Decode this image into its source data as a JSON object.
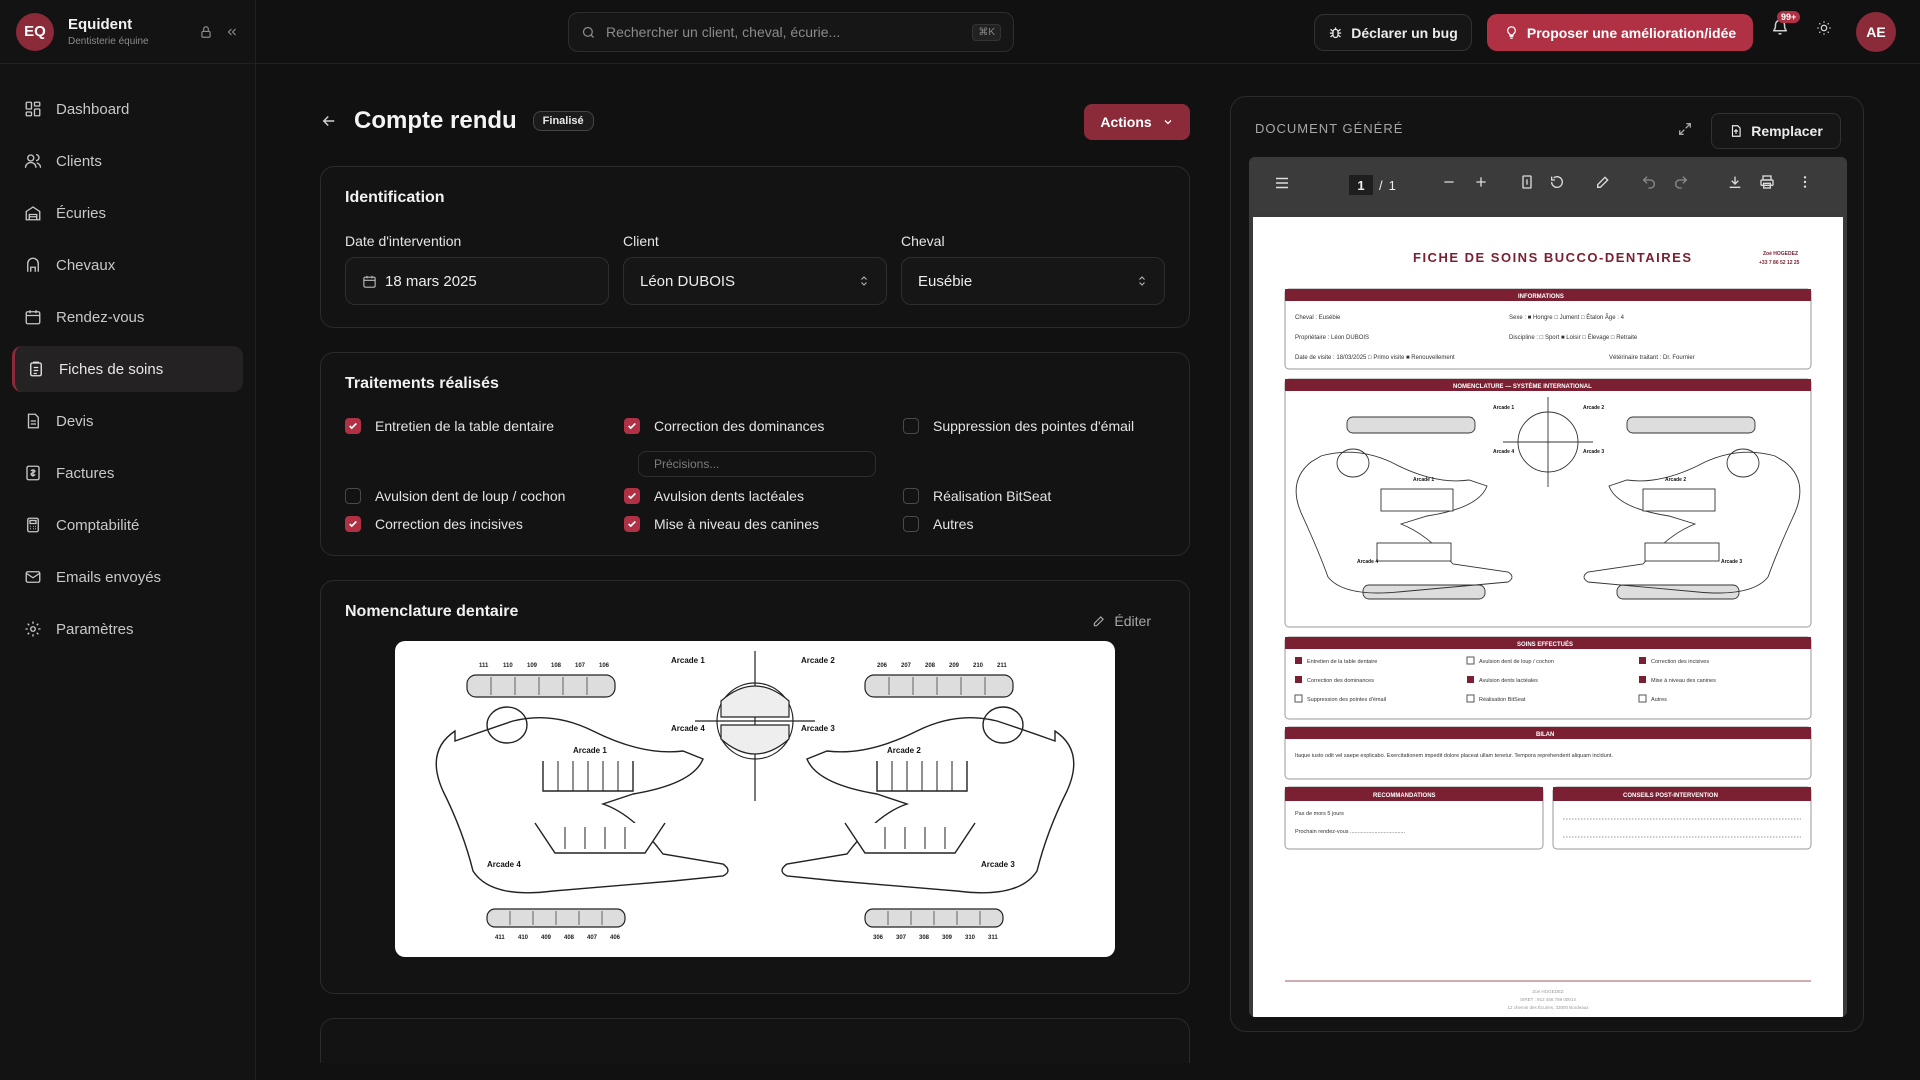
{
  "app": {
    "logo": "EQ",
    "name": "Equident",
    "subtitle": "Dentisterie équine"
  },
  "nav": [
    {
      "label": "Dashboard",
      "icon": "dashboard-icon"
    },
    {
      "label": "Clients",
      "icon": "users-icon"
    },
    {
      "label": "Écuries",
      "icon": "stable-icon"
    },
    {
      "label": "Chevaux",
      "icon": "horse-icon"
    },
    {
      "label": "Rendez-vous",
      "icon": "calendar-icon"
    },
    {
      "label": "Fiches de soins",
      "icon": "clipboard-icon",
      "active": true
    },
    {
      "label": "Devis",
      "icon": "file-icon"
    },
    {
      "label": "Factures",
      "icon": "invoice-icon"
    },
    {
      "label": "Comptabilité",
      "icon": "calculator-icon"
    },
    {
      "label": "Emails envoyés",
      "icon": "mail-icon"
    },
    {
      "label": "Paramètres",
      "icon": "gear-icon"
    }
  ],
  "topbar": {
    "search_placeholder": "Rechercher un client, cheval, écurie...",
    "search_shortcut": "⌘K",
    "bug_label": "Déclarer un bug",
    "idea_label": "Proposer une amélioration/idée",
    "notif_count": "99+",
    "avatar": "AE"
  },
  "page": {
    "title": "Compte rendu",
    "status": "Finalisé",
    "actions_label": "Actions"
  },
  "identification": {
    "title": "Identification",
    "date_label": "Date d'intervention",
    "date_value": "18 mars 2025",
    "client_label": "Client",
    "client_value": "Léon DUBOIS",
    "horse_label": "Cheval",
    "horse_value": "Eusébie"
  },
  "treatments": {
    "title": "Traitements réalisés",
    "precisions_placeholder": "Précisions...",
    "items": [
      {
        "label": "Entretien de la table dentaire",
        "checked": true
      },
      {
        "label": "Correction des dominances",
        "checked": true
      },
      {
        "label": "Suppression des pointes d'émail",
        "checked": false
      },
      {
        "label": "Avulsion dent de loup / cochon",
        "checked": false
      },
      {
        "label": "Avulsion dents lactéales",
        "checked": true
      },
      {
        "label": "Réalisation BitSeat",
        "checked": false
      },
      {
        "label": "Correction des incisives",
        "checked": true
      },
      {
        "label": "Mise à niveau des canines",
        "checked": true
      },
      {
        "label": "Autres",
        "checked": false
      }
    ]
  },
  "nomenclature": {
    "title": "Nomenclature dentaire",
    "edit_label": "Éditer",
    "arcades": [
      "Arcade 1",
      "Arcade 2",
      "Arcade 3",
      "Arcade 4"
    ],
    "top_left_teeth": [
      "111",
      "110",
      "109",
      "108",
      "107",
      "106"
    ],
    "top_right_teeth": [
      "206",
      "207",
      "208",
      "209",
      "210",
      "211"
    ],
    "bottom_left_teeth": [
      "411",
      "410",
      "409",
      "408",
      "407",
      "406"
    ],
    "bottom_right_teeth": [
      "306",
      "307",
      "308",
      "309",
      "310",
      "311"
    ]
  },
  "document": {
    "title": "DOCUMENT GÉNÉRÉ",
    "replace_label": "Remplacer",
    "page_current": "1",
    "page_total": "1",
    "sheet": {
      "title": "FICHE DE SOINS BUCCO-DENTAIRES",
      "practitioner": "Zoé HOGEDEZ",
      "phone": "+33 7 86 52 12 25",
      "info_header": "INFORMATIONS",
      "horse_line": "Cheval : Eusébie",
      "sex_line": "Sexe : ■ Hongre  □ Jument  □ Étalon   Âge : 4",
      "owner_line": "Propriétaire : Léon DUBOIS",
      "discipline_line": "Discipline : □ Sport  ■ Loisir  □ Élevage  □ Retraite",
      "visit_line": "Date de visite : 18/03/2025  □ Primo visite   ■ Renouvellement",
      "vet_line": "Vétérinaire traitant : Dr. Fournier",
      "nomenclature_header": "NOMENCLATURE — SYSTÈME INTERNATIONAL",
      "soins_header": "SOINS EFFECTUÉS",
      "soins": [
        {
          "label": "Entretien de la table dentaire",
          "checked": true
        },
        {
          "label": "Avulsion dent de loup / cochon",
          "checked": false
        },
        {
          "label": "Correction des incisives",
          "checked": true
        },
        {
          "label": "Correction des dominances",
          "checked": true
        },
        {
          "label": "Avulsion dents lactéales",
          "checked": true
        },
        {
          "label": "Mise à niveau des canines",
          "checked": true
        },
        {
          "label": "Suppression des pointes d'émail",
          "checked": false
        },
        {
          "label": "Réalisation BitSeat",
          "checked": false
        },
        {
          "label": "Autres",
          "checked": false
        }
      ],
      "bilan_header": "BILAN",
      "bilan_text": "Itaque iusto odit vel saepe explicabo. Exercitationem impedit dolore placeat ullam tenetur. Tempora reprehenderit aliquam incidunt.",
      "reco_header": "RECOMMANDATIONS",
      "reco_1": "Pas de mors 5 jours",
      "reco_2": "Prochain rendez-vous ....................................",
      "conseils_header": "CONSEILS POST-INTERVENTION",
      "footer_1": "Zoé HOGEDEZ",
      "footer_2": "SIRET : 912 456 789 00014",
      "footer_3": "12 chemin des Écuries, 33000 Bordeaux"
    }
  },
  "colors": {
    "accent": "#b03044",
    "accent_dark": "#8b2a38",
    "bg": "#121112"
  }
}
